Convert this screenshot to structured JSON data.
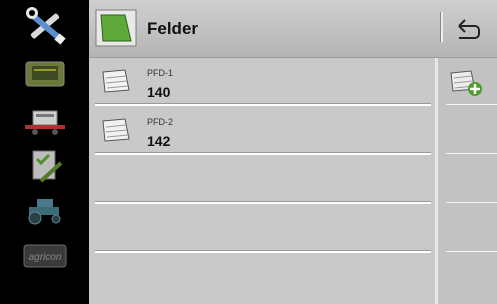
{
  "header": {
    "title": "Felder"
  },
  "fields": [
    {
      "label": "PFD-1",
      "value": "140"
    },
    {
      "label": "PFD-2",
      "value": "142"
    }
  ],
  "sidebar": {
    "items": [
      "wrench-screwdriver-icon",
      "terminal-icon",
      "implement-icon",
      "task-icon",
      "tractor-icon",
      "agricon-logo"
    ]
  },
  "colors": {
    "accent": "#5fa83a",
    "header": "#c4c4c4",
    "list": "#c9c9c9"
  }
}
